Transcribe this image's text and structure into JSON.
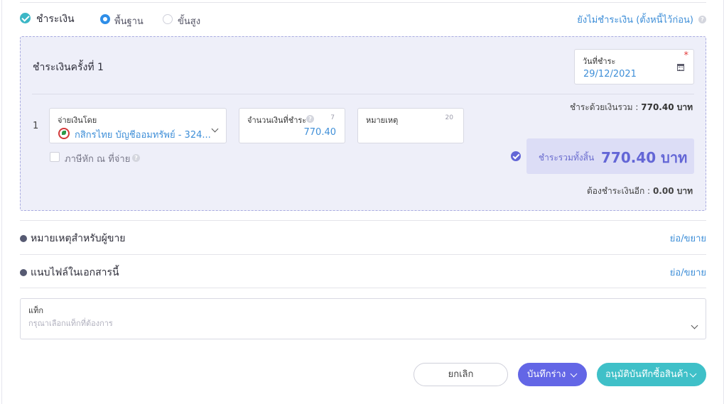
{
  "payment": {
    "title": "ชำระเงิน",
    "mode_basic": "พื้นฐาน",
    "mode_advanced": "ขั้นสูง",
    "unpaid_link": "ยังไม่ชำระเงิน (ตั้งหนี้ไว้ก่อน)"
  },
  "installment": {
    "title": "ชำระเงินครั้งที่ 1",
    "date_label": "วันที่ชำระ",
    "date_value": "29/12/2021",
    "required_mark": "*",
    "row_number": "1",
    "pay_by_label": "จ่ายเงินโดย",
    "pay_by_value": "กสิกรไทย บัญชีออมทรัพย์ - 324...",
    "amount_label": "จำนวนเงินที่ชำระ",
    "amount_count": "7",
    "amount_value": "770.40",
    "note_label": "หมายเหตุ",
    "note_count": "20",
    "withholding_tax_label": "ภาษีหัก ณ ที่จ่าย",
    "cash_total_label": "ชำระด้วยเงินรวม :",
    "cash_total_value": "770.40 บาท",
    "grand_total_label": "ชำระรวมทั้งสิ้น",
    "grand_total_value": "770.40 บาท",
    "remaining_label": "ต้องชำระเงินอีก :",
    "remaining_value": "0.00 บาท"
  },
  "sections": [
    {
      "title": "หมายเหตุสำหรับผู้ขาย",
      "toggle": "ย่อ/ขยาย"
    },
    {
      "title": "แนบไฟล์ในเอกสารนี้",
      "toggle": "ย่อ/ขยาย"
    }
  ],
  "tag": {
    "label": "แท็ก",
    "placeholder": "กรุณาเลือกแท็กที่ต้องการ"
  },
  "actions": {
    "cancel": "ยกเลิก",
    "save_draft": "บันทึกร่าง",
    "approve": "อนุมัติบันทึกซื้อสินค้า"
  },
  "colors": {
    "accent_teal": "#3fc0c8",
    "accent_purple": "#6366e6",
    "link_blue": "#3f8fd8"
  }
}
